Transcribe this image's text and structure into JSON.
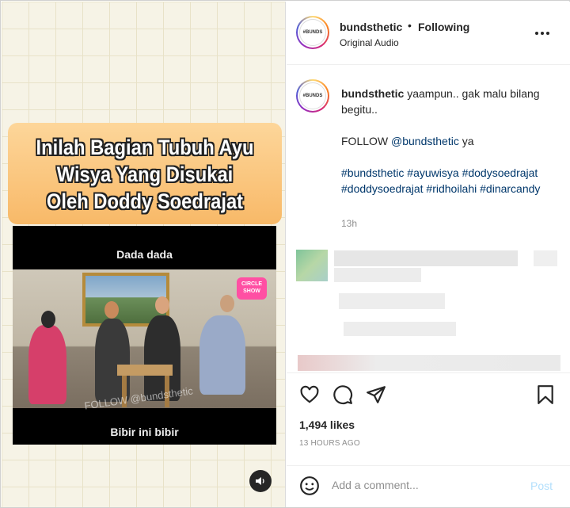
{
  "media": {
    "headline_lines": [
      "Inilah Bagian Tubuh Ayu",
      "Wisya Yang Disukai",
      "Oleh Doddy Soedrajat"
    ],
    "caption_top": "Dada dada",
    "caption_bottom": "Bibir ini bibir",
    "watermark": "FOLLOW @bundsthetic",
    "mute_icon": "speaker-icon"
  },
  "header": {
    "username": "bundsthetic",
    "separator": "•",
    "follow_status": "Following",
    "audio": "Original Audio",
    "more_icon": "more-options-icon"
  },
  "caption": {
    "username": "bundsthetic",
    "text": "yaampun.. gak malu bilang begitu..",
    "follow_prefix": "FOLLOW ",
    "follow_mention": "@bundsthetic",
    "follow_suffix": " ya",
    "hashtags": [
      "#bundsthetic",
      "#ayuwisya",
      "#dodysoedrajat",
      "#doddysoedrajat",
      "#ridhoilahi",
      "#dinarcandy"
    ],
    "time": "13h"
  },
  "actions": {
    "icons": [
      "heart-icon",
      "comment-icon",
      "share-icon",
      "bookmark-icon"
    ],
    "likes": "1,494 likes",
    "posted": "13 HOURS AGO"
  },
  "comment_bar": {
    "placeholder": "Add a comment...",
    "post_label": "Post",
    "accent": "#b2dffc"
  }
}
